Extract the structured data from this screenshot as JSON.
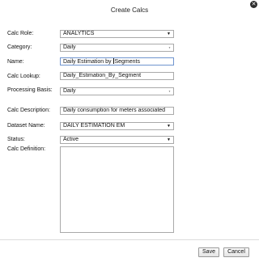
{
  "dialog": {
    "title": "Create Calcs",
    "close_icon": "close-circle-icon"
  },
  "form": {
    "calc_role": {
      "label": "Calc Role:",
      "value": "ANALYTICS"
    },
    "category": {
      "label": "Category:",
      "value": "Daily"
    },
    "name": {
      "label": "Name:",
      "value_before_cursor": "Daily Estimation by ",
      "value_after_cursor": "Segments"
    },
    "calc_lookup": {
      "label": "Calc Lookup:",
      "value": "Daily_Estimation_By_Segment"
    },
    "processing_basis": {
      "label": "Processing Basis:",
      "value": "Daily"
    },
    "calc_description": {
      "label": "Calc Description:",
      "value": "Daily consumption for meters associated"
    },
    "dataset_name": {
      "label": "Dataset Name:",
      "value": "DAILY ESTIMATION EM"
    },
    "status": {
      "label": "Status:",
      "value": "Active"
    },
    "calc_definition": {
      "label": "Calc Definition:",
      "value": ""
    }
  },
  "buttons": {
    "save_label": "Save",
    "cancel_label": "Cancel"
  },
  "icons": {
    "dropdown_caret": "▼"
  }
}
